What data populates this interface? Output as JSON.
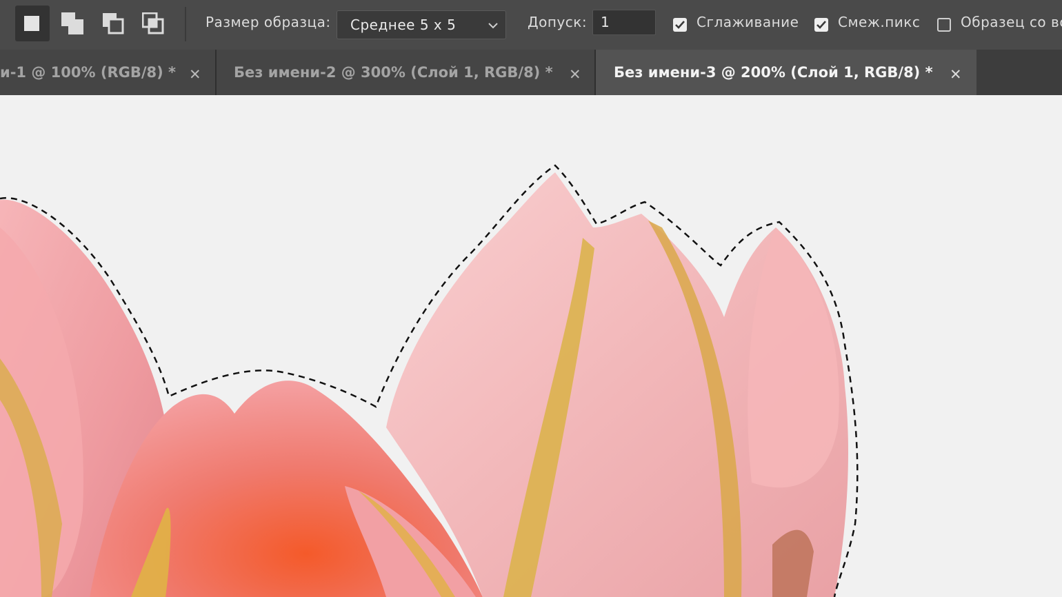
{
  "toolbar": {
    "selection_modes": [
      {
        "icon": "new-selection-icon",
        "active": true
      },
      {
        "icon": "add-to-selection-icon",
        "active": false
      },
      {
        "icon": "subtract-from-selection-icon",
        "active": false
      },
      {
        "icon": "intersect-selection-icon",
        "active": false
      }
    ],
    "sample_size_label": "Размер образца:",
    "sample_size_value": "Среднее 5 x 5",
    "tolerance_label": "Допуск:",
    "tolerance_value": "1",
    "antialias_label": "Сглаживание",
    "antialias_checked": true,
    "contiguous_label": "Смеж.пикс",
    "contiguous_checked": true,
    "sample_all_layers_label": "Образец со вс",
    "sample_all_layers_checked": false
  },
  "tabs": [
    {
      "title": "и-1 @ 100% (RGB/8) *",
      "close": "✕",
      "active": false
    },
    {
      "title": "Без имени-2 @ 300% (Слой 1, RGB/8) *",
      "close": "✕",
      "active": false
    },
    {
      "title": "Без имени-3 @ 200% (Слой 1, RGB/8) *",
      "close": "✕",
      "active": true
    }
  ],
  "colors": {
    "toolbar_bg": "#4a4a4a",
    "tab_bar_bg": "#3d3d3d",
    "active_tab_bg": "#535353",
    "canvas_bg": "#f1f1f1",
    "petal_pink": "#f2a3a8",
    "petal_coral": "#f07a6e",
    "petal_yellow": "#d8b04a"
  }
}
